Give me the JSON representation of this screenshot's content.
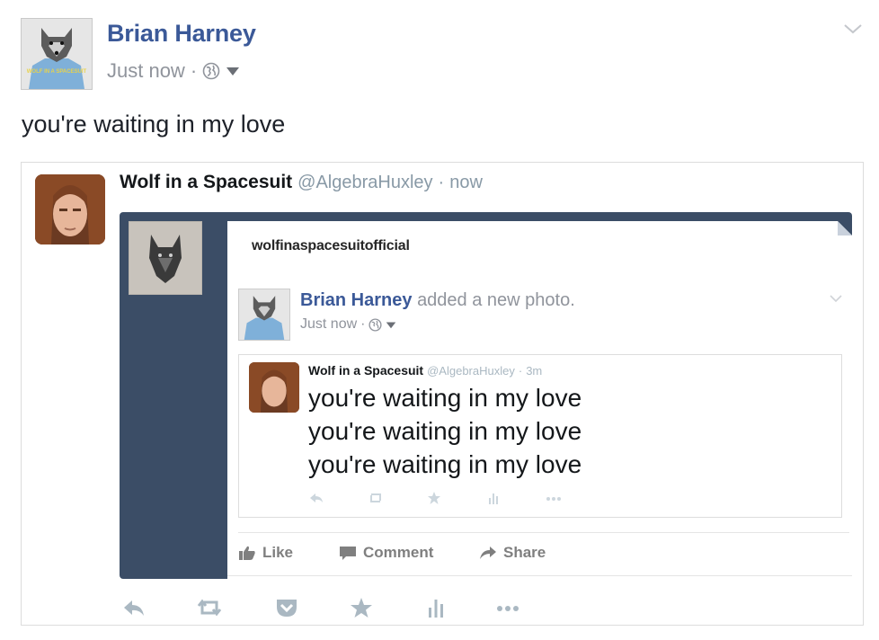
{
  "post": {
    "author": "Brian Harney",
    "timestamp": "Just now",
    "separator": "·",
    "text": "you're waiting in my love",
    "avatar_shirt_text": "WOLF IN A SPACESUIT"
  },
  "tweet": {
    "name": "Wolf in a Spacesuit",
    "handle": "@AlgebraHuxley",
    "separator": "·",
    "time": "now"
  },
  "screenshot": {
    "username": "wolfinaspacesuitofficial",
    "post_author": "Brian Harney",
    "post_action": "added a new photo.",
    "post_time": "Just now",
    "separator": "·",
    "inner_tweet": {
      "name": "Wolf in a Spacesuit",
      "handle": "@AlgebraHuxley",
      "separator": "·",
      "time": "3m",
      "lines": [
        "you're waiting in my love",
        "you're waiting in my love",
        "you're waiting in my love"
      ],
      "actions": [
        "reply-icon",
        "retweet-icon",
        "favorite-icon",
        "analytics-icon",
        "more-icon"
      ]
    },
    "actions": {
      "like": "Like",
      "comment": "Comment",
      "share": "Share"
    }
  },
  "tweet_actions": [
    "reply-icon",
    "retweet-icon",
    "pocket-icon",
    "favorite-icon",
    "analytics-icon",
    "more-icon"
  ],
  "colors": {
    "facebook_blue": "#3b5998",
    "meta_gray": "#90949c",
    "twitter_gray": "#8899a6",
    "screenshot_bg": "#3b4d66"
  }
}
